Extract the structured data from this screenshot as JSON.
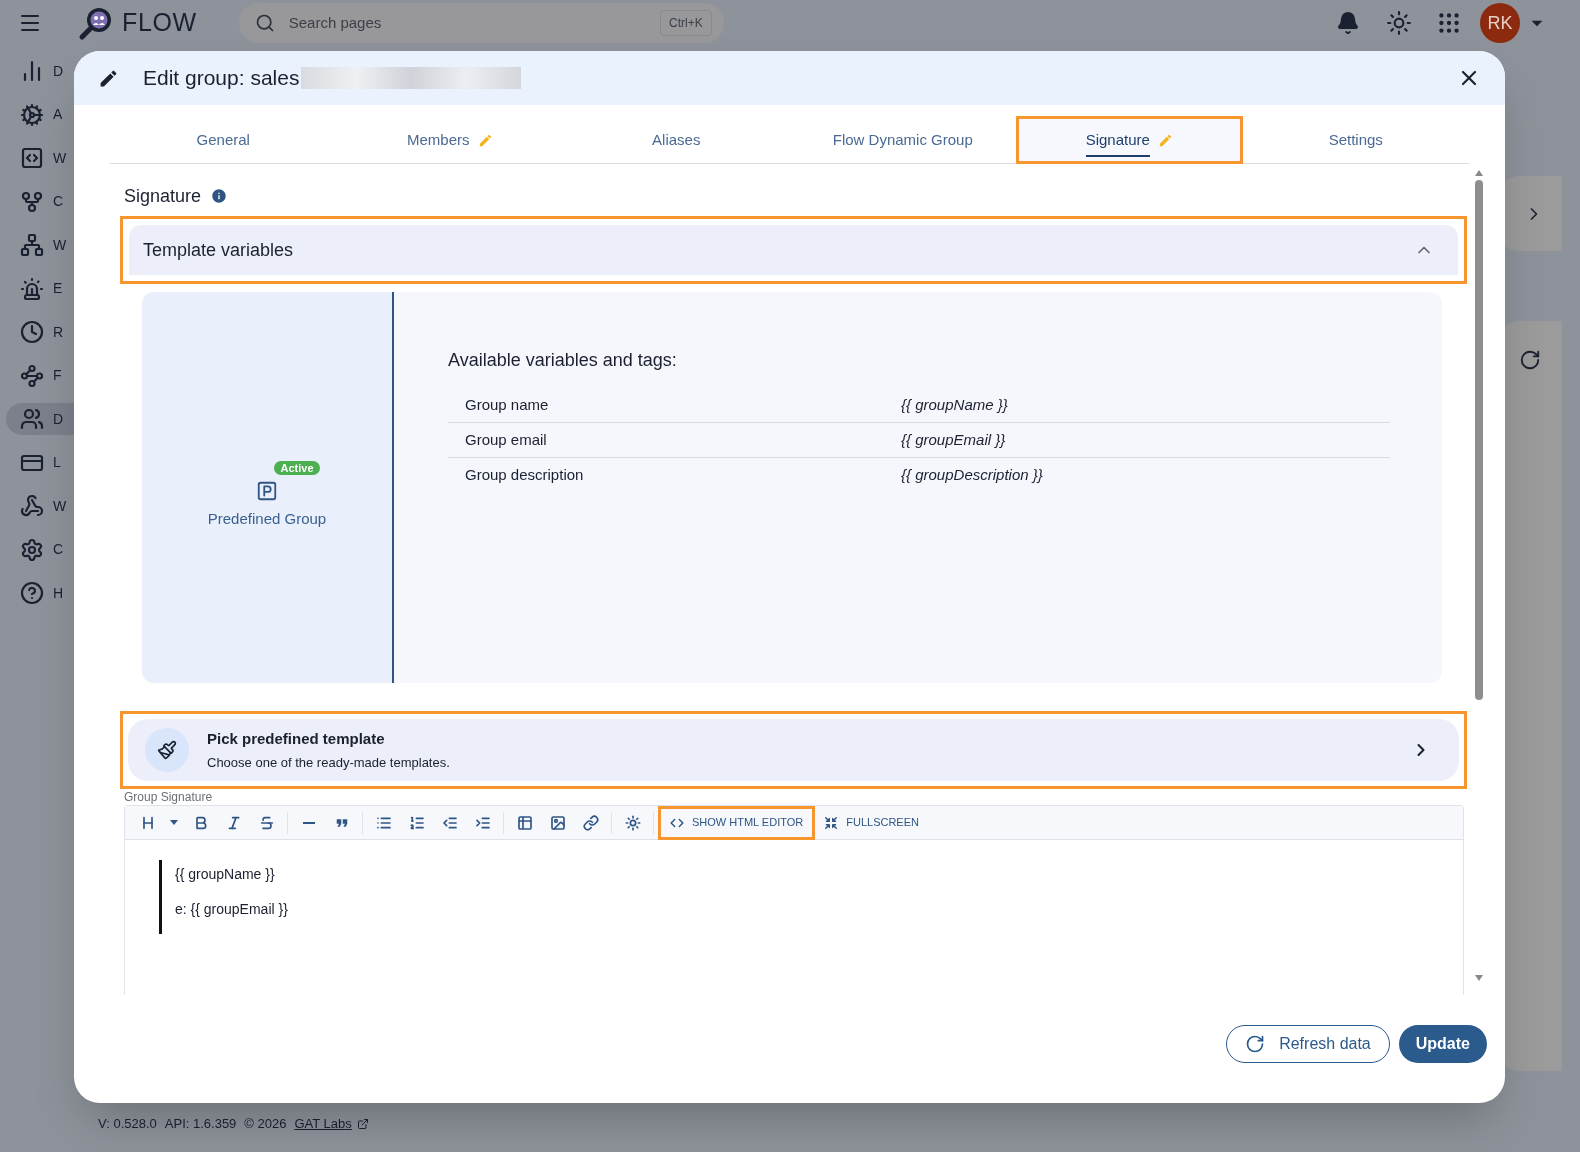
{
  "app_bar": {
    "logo_text": "FLOW",
    "search": {
      "placeholder": "Search pages",
      "shortcut": "Ctrl+K"
    },
    "avatar": "RK"
  },
  "sidebar": {
    "items": [
      {
        "label": "D",
        "selected": false
      },
      {
        "label": "A",
        "selected": false
      },
      {
        "label": "W",
        "selected": false
      },
      {
        "label": "C",
        "selected": false
      },
      {
        "label": "W",
        "selected": false
      },
      {
        "label": "E",
        "selected": false
      },
      {
        "label": "R",
        "selected": false
      },
      {
        "label": "F",
        "selected": false
      },
      {
        "label": "D",
        "selected": true
      },
      {
        "label": "L",
        "selected": false
      },
      {
        "label": "W",
        "selected": false
      },
      {
        "label": "C",
        "selected": false
      },
      {
        "label": "H",
        "selected": false
      }
    ]
  },
  "footer": {
    "version": "V: 0.528.0",
    "api": "API: 1.6.359",
    "copyright": "© 2026",
    "link": "GAT Labs"
  },
  "dialog": {
    "title": "Edit group: sales",
    "tabs": [
      {
        "label": "General",
        "selected": false,
        "edited": false,
        "highlighted": false
      },
      {
        "label": "Members",
        "selected": false,
        "edited": true,
        "highlighted": false
      },
      {
        "label": "Aliases",
        "selected": false,
        "edited": false,
        "highlighted": false
      },
      {
        "label": "Flow Dynamic Group",
        "selected": false,
        "edited": false,
        "highlighted": false
      },
      {
        "label": "Signature",
        "selected": true,
        "edited": true,
        "highlighted": true
      },
      {
        "label": "Settings",
        "selected": false,
        "edited": false,
        "highlighted": false
      }
    ],
    "section_title": "Signature",
    "accordion": {
      "title": "Template variables",
      "expanded": true,
      "highlighted": true,
      "source": {
        "badge": "Active",
        "label": "Predefined Group"
      },
      "heading": "Available variables and tags:",
      "variables": [
        {
          "name": "Group name",
          "tag": "{{ groupName }}"
        },
        {
          "name": "Group email",
          "tag": "{{ groupEmail }}"
        },
        {
          "name": "Group description",
          "tag": "{{ groupDescription }}"
        }
      ]
    },
    "template_picker": {
      "title": "Pick predefined template",
      "subtitle": "Choose one of the ready-made templates.",
      "highlighted": true
    },
    "editor": {
      "label": "Group Signature",
      "toolbar_buttons": [
        {
          "label": "SHOW HTML EDITOR",
          "kind": "code",
          "highlighted": true
        },
        {
          "label": "FULLSCREEN",
          "kind": "fullscreen",
          "highlighted": false
        }
      ],
      "lines": [
        "{{ groupName }}",
        "e: {{ groupEmail }}"
      ]
    },
    "buttons": [
      {
        "label": "Refresh data",
        "kind": "outlined"
      },
      {
        "label": "Update",
        "kind": "filled"
      }
    ]
  }
}
